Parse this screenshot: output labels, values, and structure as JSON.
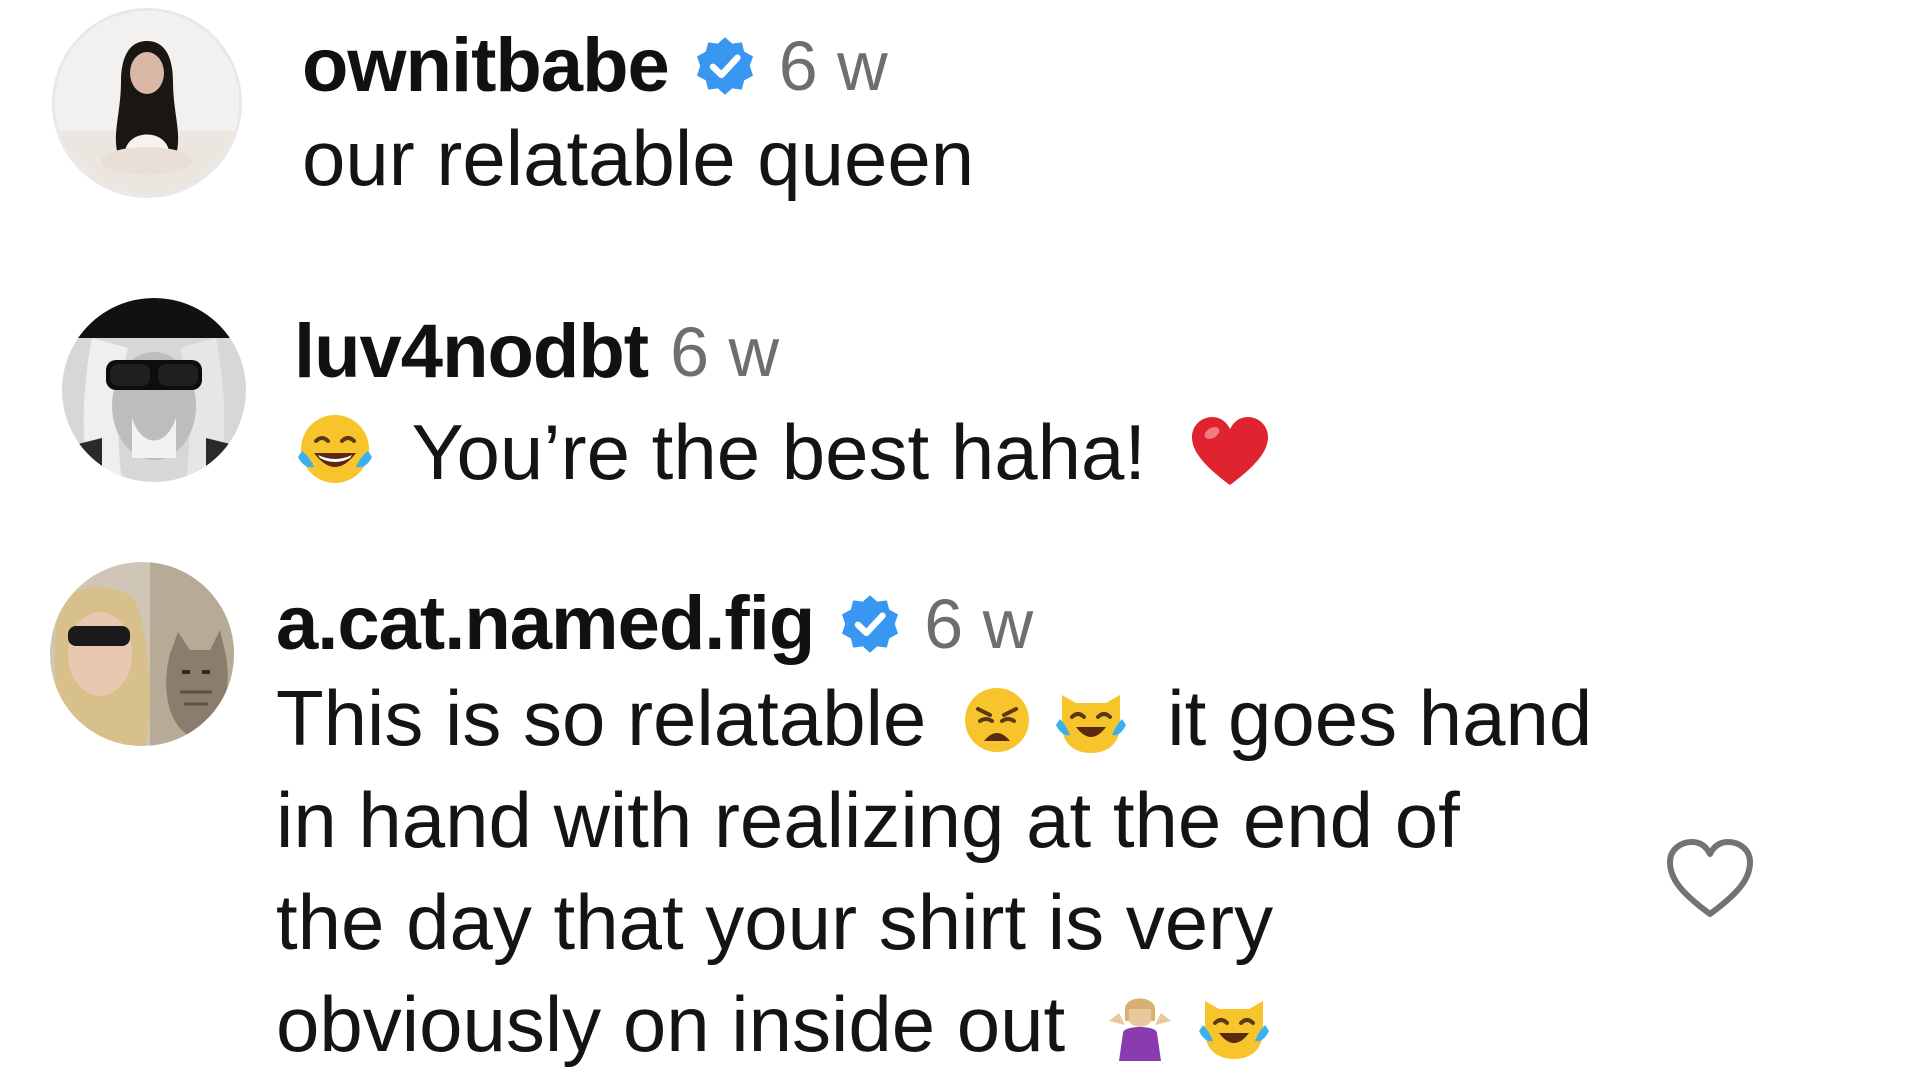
{
  "comments": [
    {
      "username": "ownitbabe",
      "verified": true,
      "time": "6 w",
      "lines": [
        "our relatable queen"
      ],
      "avatar": "woman-portrait-avatar"
    },
    {
      "username": "luv4nodbt",
      "verified": false,
      "time": "6 w",
      "text": "You’re the best haha!",
      "emoji_before": "face-with-tears-of-joy",
      "emoji_after": "red-heart",
      "avatar": "sunglasses-bw-avatar"
    },
    {
      "username": "a.cat.named.fig",
      "verified": true,
      "time": "6 w",
      "line1_before": "This is so relatable",
      "line1_after": "it goes hand",
      "line2": "in hand with realizing at the end of",
      "line3": "the day that your shirt is very",
      "line4": "obviously on inside out",
      "emojis_line1": [
        "weary-face",
        "cat-with-tears-of-joy"
      ],
      "emojis_line4": [
        "person-shrugging",
        "cat-with-tears-of-joy"
      ],
      "avatar": "woman-with-cat-avatar"
    }
  ],
  "icons": {
    "like": "heart-outline-icon",
    "verified": "verified-badge-icon"
  },
  "colors": {
    "verified_blue": "#3897f0",
    "timestamp_gray": "#6e6e6e",
    "heart_red": "#e0242f"
  }
}
